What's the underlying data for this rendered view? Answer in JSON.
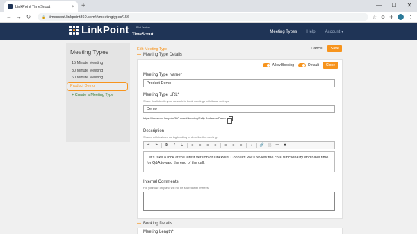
{
  "browser": {
    "tab_title": "LinkPoint TimeScout",
    "tab_close": "×",
    "new_tab": "+",
    "url": "timescout.linkpoint360.com/#/meetingtypes/156",
    "win_min": "—",
    "win_max": "☐",
    "win_close": "✕",
    "back": "←",
    "forward": "→",
    "reload": "↻",
    "star": "☆",
    "ext": "⚙",
    "puzzle": "✚",
    "menu": "⋮"
  },
  "app": {
    "brand": "LinkPoint",
    "sub_brand": "TimeScout",
    "pilot": "Pilot Feature",
    "nav": {
      "meeting_types": "Meeting Types",
      "help": "Help",
      "account": "Account ▾"
    }
  },
  "sidebar": {
    "title": "Meeting Types",
    "items": [
      "15 Minute Meeting",
      "30 Minute Meeting",
      "60 Minute Meeting",
      "Product Demo"
    ],
    "create": "+ Create a Meeting Type"
  },
  "main": {
    "breadcrumb": "Edit Meeting Type",
    "cancel": "Cancel",
    "save": "Save",
    "details_title": "Meeting Type Details",
    "allow_booking": "Allow Booking",
    "default": "Default",
    "clone": "Clone",
    "name_label": "Meeting Type Name*",
    "name_value": "Product Demo",
    "url_label": "Meeting Type URL*",
    "url_help": "Share this link with your network to book meetings with these settings.",
    "url_value": "Demo",
    "full_url": "https://timescout.linkpoint360.com/#/booking/Sally-Anderson/Demo",
    "desc_label": "Description",
    "desc_help": "Shared with invitees during booking to describe the meeting.",
    "desc_text": "Let's take a look at the latest version of LinkPoint Connect! We'll review the core functionality and have time for Q&A toward the end of the call.",
    "toolbar": [
      "↶",
      "↷",
      "B",
      "I",
      "U",
      "≡",
      "≡",
      "≡",
      "≡",
      "≡",
      "≡",
      "≡",
      "↕",
      "🔗",
      "⛓",
      "—",
      "✖"
    ],
    "comments_label": "Internal Comments",
    "comments_help": "For your use only and will not be shared with invitees.",
    "booking_title": "Booking Details",
    "length_label": "Meeting Length*"
  },
  "colors": {
    "accent": "#f7941d",
    "header": "#1f3456"
  }
}
